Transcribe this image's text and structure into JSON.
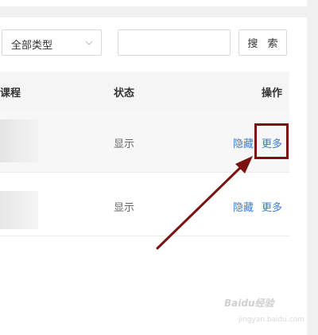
{
  "filters": {
    "type_select_value": "全部类型",
    "search_placeholder": "",
    "search_button_label": "搜 索"
  },
  "table": {
    "headers": {
      "course": "课程",
      "status": "状态",
      "actions": "操作"
    },
    "rows": [
      {
        "status": "显示",
        "hide_label": "隐藏",
        "more_label": "更多"
      },
      {
        "status": "显示",
        "hide_label": "隐藏",
        "more_label": "更多"
      }
    ]
  },
  "annotation": {
    "arrow_color": "#7a1212"
  },
  "watermark": {
    "text": "Baidu经验",
    "sub": "jingyan.baidu.com"
  }
}
